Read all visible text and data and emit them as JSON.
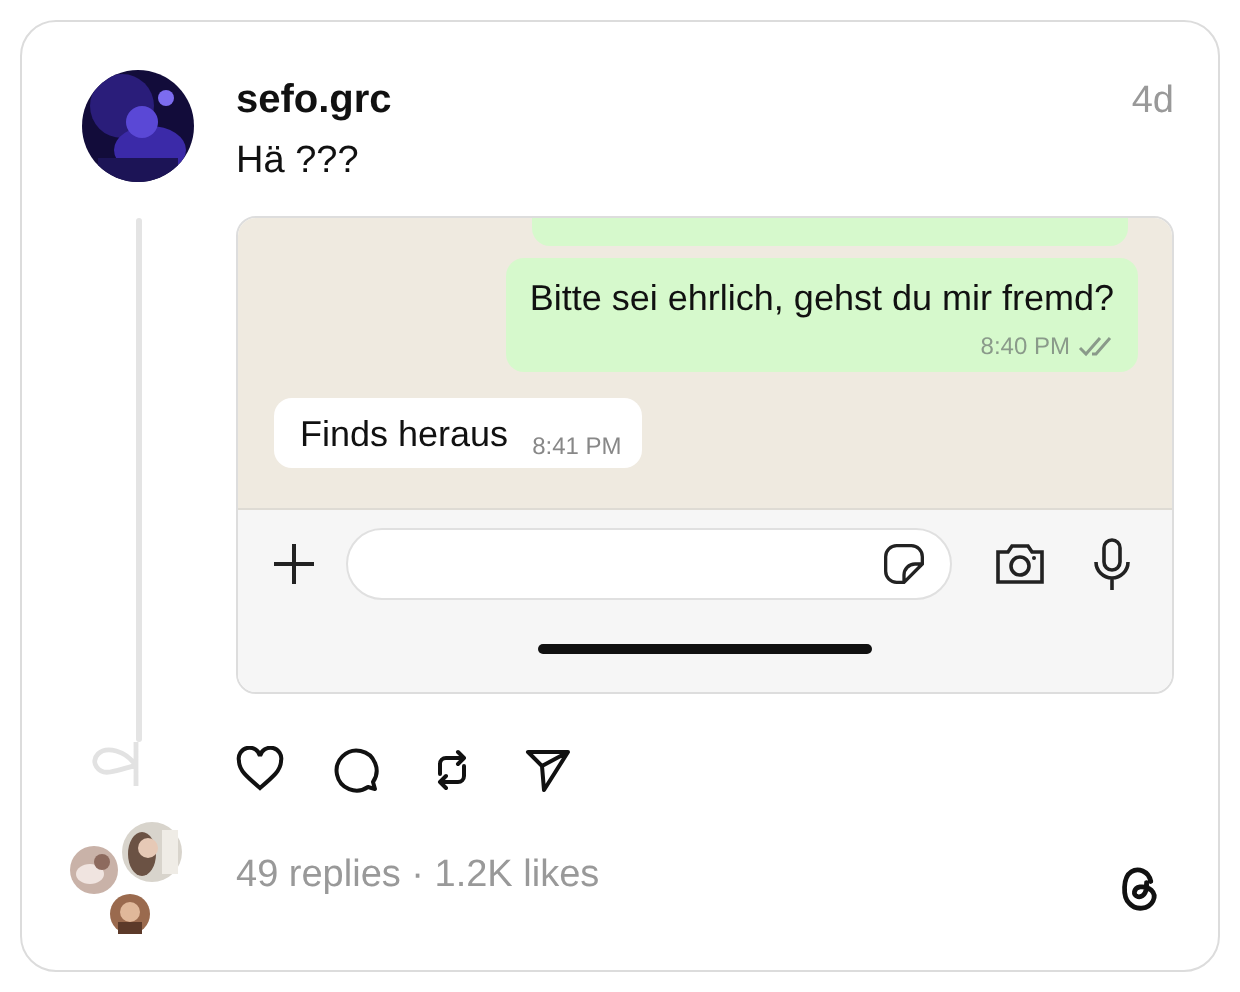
{
  "post": {
    "username": "sefo.grc",
    "time": "4d",
    "text": "Hä ???",
    "liked": false
  },
  "screenshot": {
    "messages": [
      {
        "kind": "partial"
      },
      {
        "kind": "sent",
        "text": "Bitte sei ehrlich, gehst du mir fremd?",
        "time": "8:40 PM",
        "read": true
      },
      {
        "kind": "received",
        "text": "Finds heraus",
        "time": "8:41 PM"
      }
    ]
  },
  "stats": "49 replies · 1.2K likes"
}
